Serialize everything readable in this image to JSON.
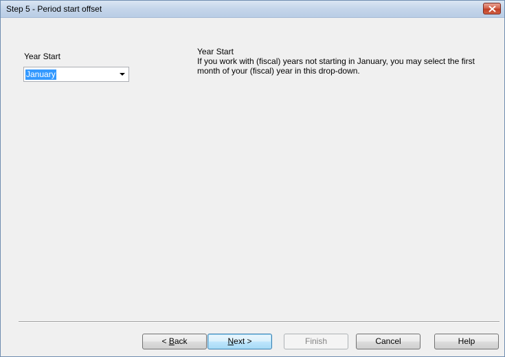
{
  "window": {
    "title": "Step 5 - Period start offset",
    "close_icon": "close-icon"
  },
  "form": {
    "year_start_label": "Year Start",
    "year_start_value": "January"
  },
  "help": {
    "heading": "Year Start",
    "body": "If you work with (fiscal) years not starting in January, you may select the first month of your (fiscal) year in this drop-down."
  },
  "buttons": {
    "back": {
      "mnemonic": "B",
      "rest": "ack",
      "prefix": "< "
    },
    "next": {
      "mnemonic": "N",
      "rest": "ext >"
    },
    "finish": {
      "label": "Finish",
      "enabled": false
    },
    "cancel": {
      "label": "Cancel"
    },
    "help": {
      "label": "Help"
    }
  },
  "colors": {
    "selection": "#3399ff",
    "close_button": "#c13f25",
    "titlebar": "#c4d5ea",
    "dialog_background": "#f0f0f0"
  }
}
